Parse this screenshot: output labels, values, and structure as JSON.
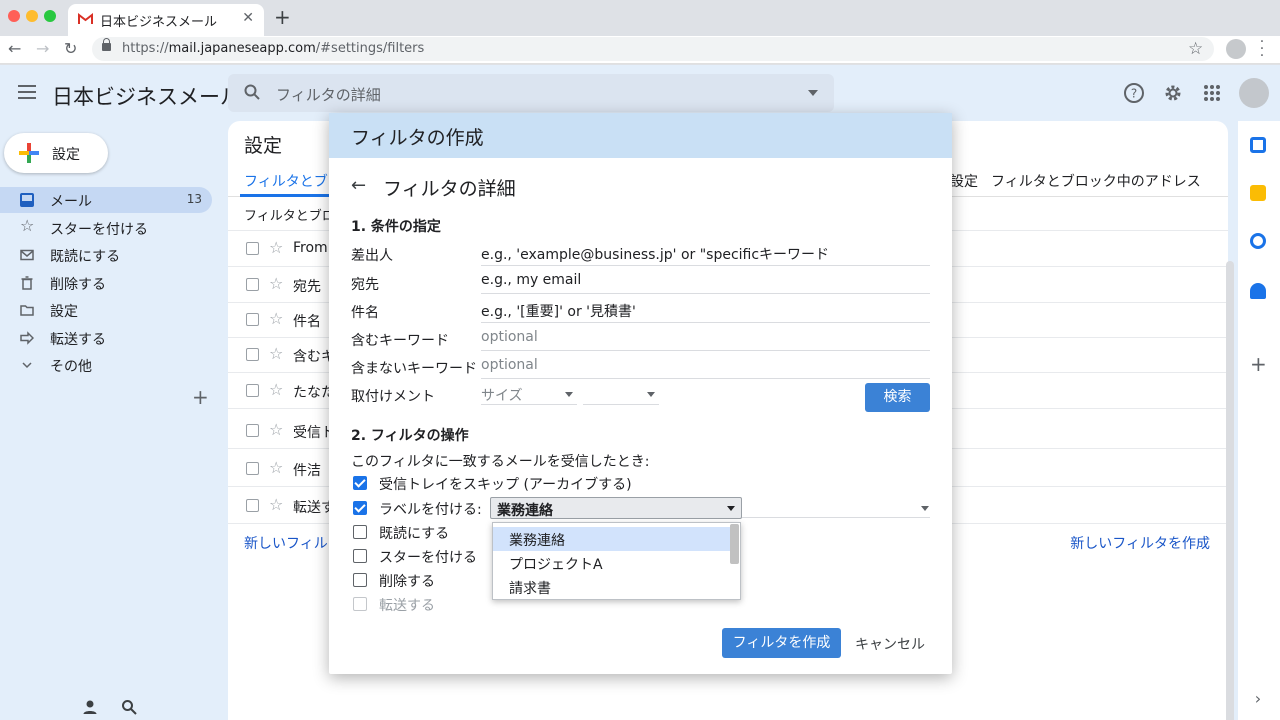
{
  "browser": {
    "tab_title": "日本ビジネスメール",
    "url_scheme": "https://",
    "url_host": "mail.japaneseapp.com",
    "url_path": "/#settings/filters"
  },
  "app": {
    "title": "日本ビジネスメール",
    "search_placeholder": "フィルタの詳細"
  },
  "sidebar": {
    "compose_label": "設定",
    "items": [
      {
        "label": "メール",
        "icon": "inbox-icon",
        "count": "13",
        "active": true
      },
      {
        "label": "スターを付ける",
        "icon": "star-icon"
      },
      {
        "label": "既読にする",
        "icon": "envelope-icon"
      },
      {
        "label": "削除する",
        "icon": "trash-icon"
      },
      {
        "label": "設定",
        "icon": "folder-icon"
      },
      {
        "label": "転送する",
        "icon": "forward-icon"
      },
      {
        "label": "その他",
        "icon": "chevron-down-icon"
      }
    ]
  },
  "settings": {
    "title": "設定",
    "tab_active": "フィルタとブロ",
    "tab_right_1": "設定",
    "tab_right_2": "フィルタとブロック中のアドレス",
    "list_header": "フィルタとブロ",
    "rows": [
      "From",
      "宛先",
      "件名",
      "含むキ",
      "たなた",
      "受信ト",
      "件洁",
      "転送す"
    ],
    "new_filter_left": "新しいフィルタ",
    "new_filter_right": "新しいフィルタを作成"
  },
  "dialog": {
    "title": "フィルタの作成",
    "subtitle": "フィルタの詳細",
    "section1": "1. 条件の指定",
    "fields": {
      "from_label": "差出人",
      "from_value": "e.g., 'example@business.jp' or \"specificキーワード",
      "to_label": "宛先",
      "to_value_prefix": "e.g.,",
      "to_value": "my email",
      "subject_label": "件名",
      "subject_value_prefix": "e.g.,",
      "subject_value": "'[重要]' or '見積書'",
      "has_words_label": "含むキーワード",
      "has_words_placeholder": "optional",
      "not_words_label": "含まないキーワード",
      "not_words_placeholder": "optional",
      "attachment_label": "取付けメント",
      "size_select": "サイズ"
    },
    "search_button": "検索",
    "section2": "2. フィルタの操作",
    "action_intro": "このフィルタに一致するメールを受信したとき:",
    "actions": {
      "skip_inbox": {
        "label": "受信トレイをスキップ (アーカイブする)",
        "checked": true
      },
      "apply_label": {
        "label": "ラベルを付ける:",
        "checked": true
      },
      "mark_read": {
        "label": "既読にする",
        "checked": false
      },
      "star": {
        "label": "スターを付ける",
        "checked": false
      },
      "delete": {
        "label": "削除する",
        "checked": false
      },
      "forward": {
        "label": "転送する",
        "checked": false,
        "disabled": true
      }
    },
    "label_selected": "業務連絡",
    "label_options": [
      "業務連絡",
      "プロジェクトA",
      "請求書"
    ],
    "create_button": "フィルタを作成",
    "cancel_button": "キャンセル"
  },
  "colors": {
    "accent": "#1a73e8",
    "button": "#3b82d6",
    "app_bg": "#e3eefa",
    "dialog_header": "#c9e0f5"
  }
}
